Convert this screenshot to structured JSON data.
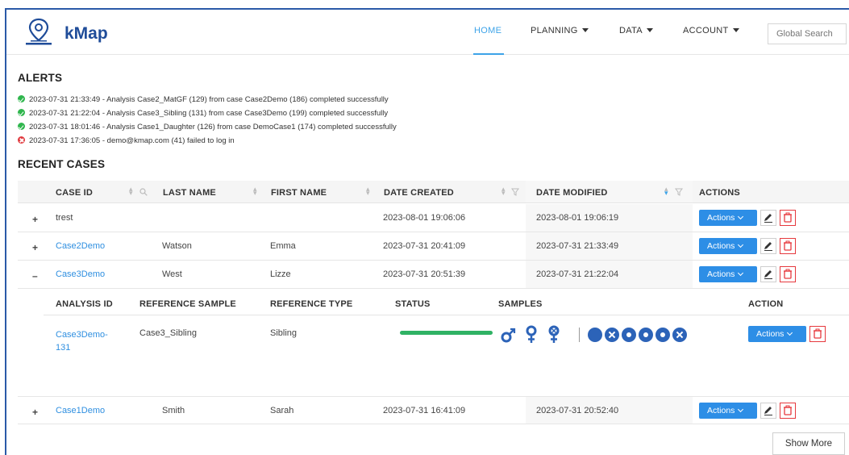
{
  "header": {
    "brand": "kMap",
    "nav": [
      {
        "label": "HOME",
        "active": true
      },
      {
        "label": "PLANNING"
      },
      {
        "label": "DATA"
      },
      {
        "label": "ACCOUNT"
      }
    ],
    "search_placeholder": "Global Search"
  },
  "alerts": {
    "title": "ALERTS",
    "items": [
      {
        "status": "success",
        "text": "2023-07-31 21:33:49 - Analysis Case2_MatGF (129) from case Case2Demo (186) completed successfully"
      },
      {
        "status": "success",
        "text": "2023-07-31 21:22:04 - Analysis Case3_Sibling (131) from case Case3Demo (199) completed successfully"
      },
      {
        "status": "success",
        "text": "2023-07-31 18:01:46 - Analysis Case1_Daughter (126) from case DemoCase1 (174) completed successfully"
      },
      {
        "status": "error",
        "text": "2023-07-31 17:36:05 - demo@kmap.com (41) failed to log in"
      }
    ]
  },
  "recent_cases": {
    "title": "RECENT CASES",
    "columns": [
      "CASE ID",
      "LAST NAME",
      "FIRST NAME",
      "DATE CREATED",
      "DATE MODIFIED",
      "ACTIONS"
    ],
    "rows": [
      {
        "expander": "+",
        "case_id": "trest",
        "last_name": "",
        "first_name": "",
        "created": "2023-08-01 19:06:06",
        "modified": "2023-08-01 19:06:19",
        "link": false
      },
      {
        "expander": "+",
        "case_id": "Case2Demo",
        "last_name": "Watson",
        "first_name": "Emma",
        "created": "2023-07-31 20:41:09",
        "modified": "2023-07-31 21:33:49",
        "link": true
      },
      {
        "expander": "–",
        "case_id": "Case3Demo",
        "last_name": "West",
        "first_name": "Lizze",
        "created": "2023-07-31 20:51:39",
        "modified": "2023-07-31 21:22:04",
        "link": true
      },
      {
        "expander": "+",
        "case_id": "Case1Demo",
        "last_name": "Smith",
        "first_name": "Sarah",
        "created": "2023-07-31 16:41:09",
        "modified": "2023-07-31 20:52:40",
        "link": true
      }
    ],
    "actions_label": "Actions",
    "analysis": {
      "columns": [
        "ANALYSIS ID",
        "REFERENCE SAMPLE",
        "REFERENCE TYPE",
        "STATUS",
        "SAMPLES",
        "ACTION"
      ],
      "row": {
        "analysis_id_line1": "Case3Demo-",
        "analysis_id_line2": "131",
        "reference_sample": "Case3_Sibling",
        "reference_type": "Sibling",
        "status_progress": 1.0
      }
    },
    "show_more": "Show More"
  },
  "colors": {
    "brand": "#1f4c99",
    "accent": "#2d8ee6",
    "success": "#2fb264",
    "error": "#e0393e"
  }
}
